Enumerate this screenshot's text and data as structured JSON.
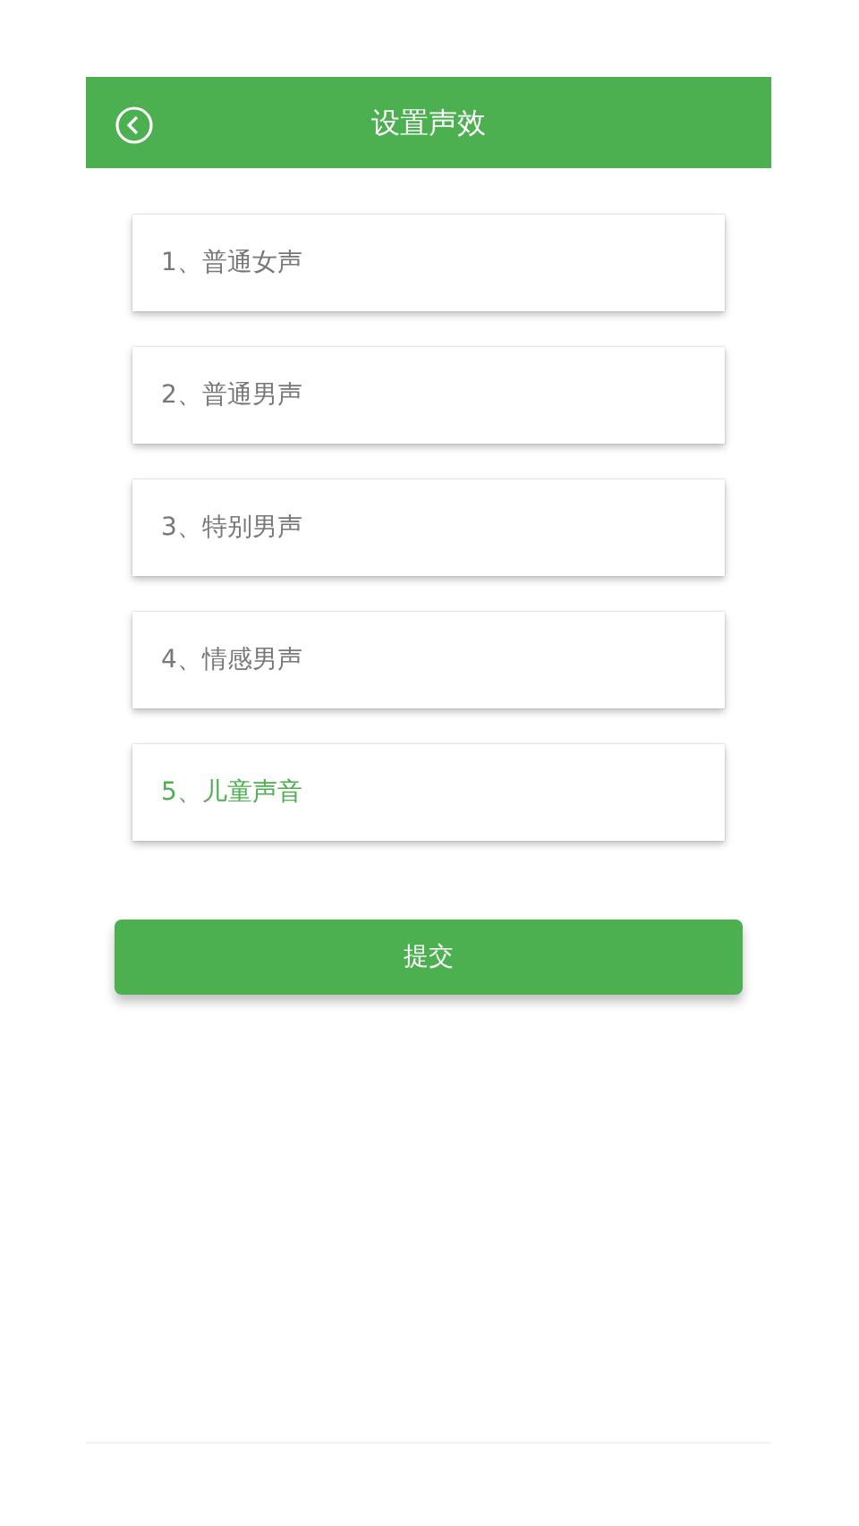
{
  "header": {
    "title": "设置声效"
  },
  "options": [
    {
      "label": "1、普通女声",
      "selected": false
    },
    {
      "label": "2、普通男声",
      "selected": false
    },
    {
      "label": "3、特别男声",
      "selected": false
    },
    {
      "label": "4、情感男声",
      "selected": false
    },
    {
      "label": "5、儿童声音",
      "selected": true
    }
  ],
  "submit": {
    "label": "提交"
  }
}
